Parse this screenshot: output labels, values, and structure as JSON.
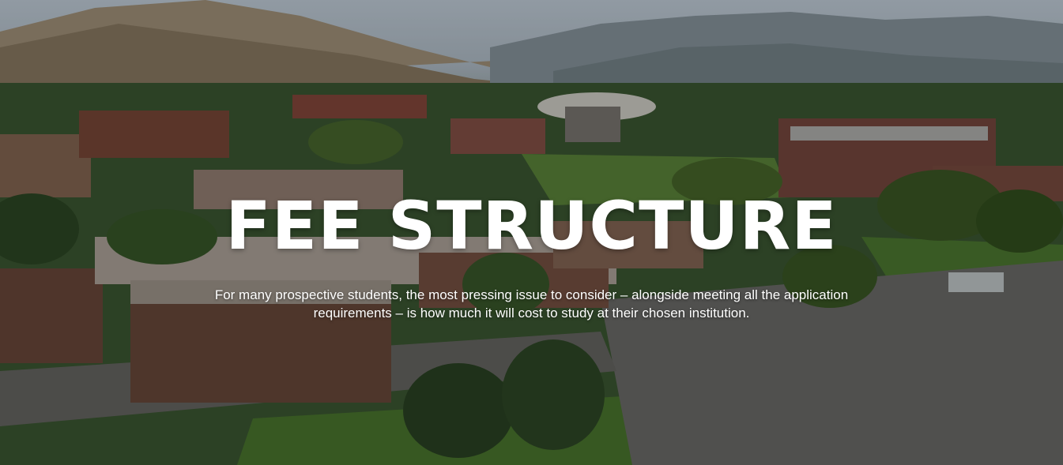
{
  "hero": {
    "title": "FEE STRUCTURE",
    "subtitle": "For many prospective students, the most pressing issue to consider – alongside meeting all the application requirements – is how much it will cost to study at their chosen institution."
  },
  "colors": {
    "title_text": "#ffffff",
    "overlay": "rgba(0,0,0,0.28)"
  }
}
